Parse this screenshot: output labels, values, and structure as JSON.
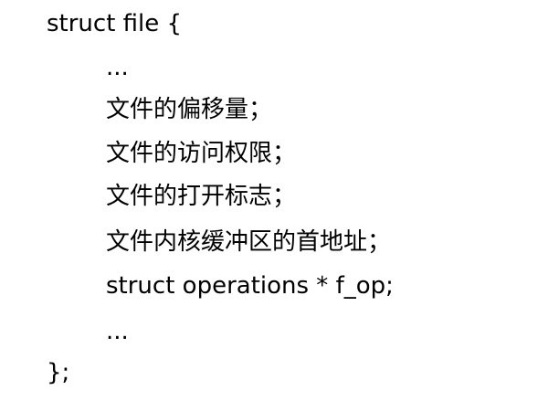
{
  "code": {
    "lines": [
      "struct file {",
      "...",
      "文件的偏移量；",
      "文件的访问权限；",
      "文件的打开标志；",
      "文件内核缓冲区的首地址；",
      "struct operations * f_op;",
      "...",
      "};"
    ]
  }
}
